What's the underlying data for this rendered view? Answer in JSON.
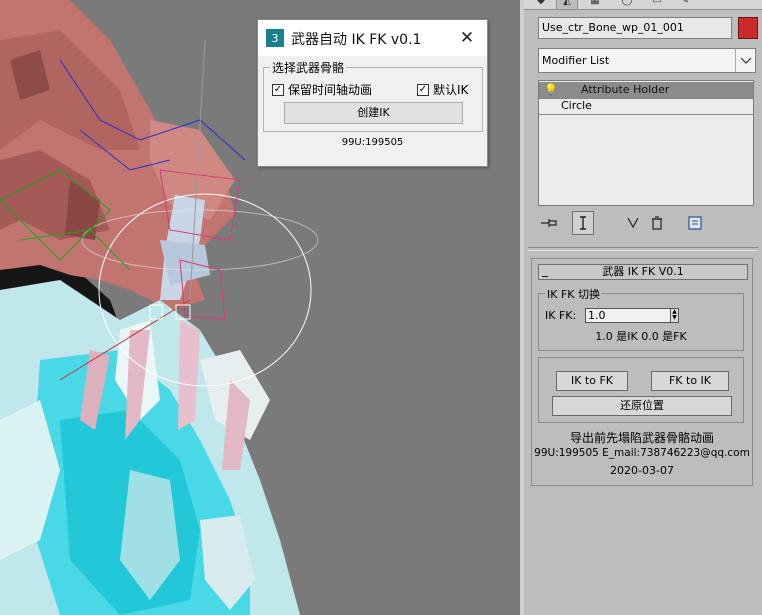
{
  "dialog": {
    "title": "武器自动 IK FK v0.1",
    "close_glyph": "✕",
    "group_label": "选择武器骨骼",
    "checkbox_keep_anim": "保留时间轴动画",
    "checkbox_default_ik": "默认IK",
    "create_ik_button": "创建IK",
    "footer": "99U:199505"
  },
  "command_panel": {
    "object_name": "Use_ctr_Bone_wp_01_001",
    "object_color": "#cc2a2a",
    "modifier_list": "Modifier List",
    "stack": [
      "Attribute Holder",
      "Circle"
    ],
    "tools": [
      "pin-stack-icon",
      "show-end-result-icon",
      "make-unique-icon",
      "remove-modifier-icon",
      "configure-modifier-sets-icon"
    ]
  },
  "rollout": {
    "title": "武器 IK FK V0.1",
    "collapse_glyph": "_",
    "group_label": "IK FK 切换",
    "spinner_label": "IK FK:",
    "spinner_value": "1.0",
    "hint": "1.0 是IK   0.0 是FK",
    "ik_to_fk": "IK to FK",
    "fk_to_ik": "FK to IK",
    "restore_button": "还原位置",
    "note": "导出前先塌陷武器骨骼动画",
    "contact": "99U:199505 E_mail:738746223@qq.com",
    "date": "2020-03-07"
  }
}
